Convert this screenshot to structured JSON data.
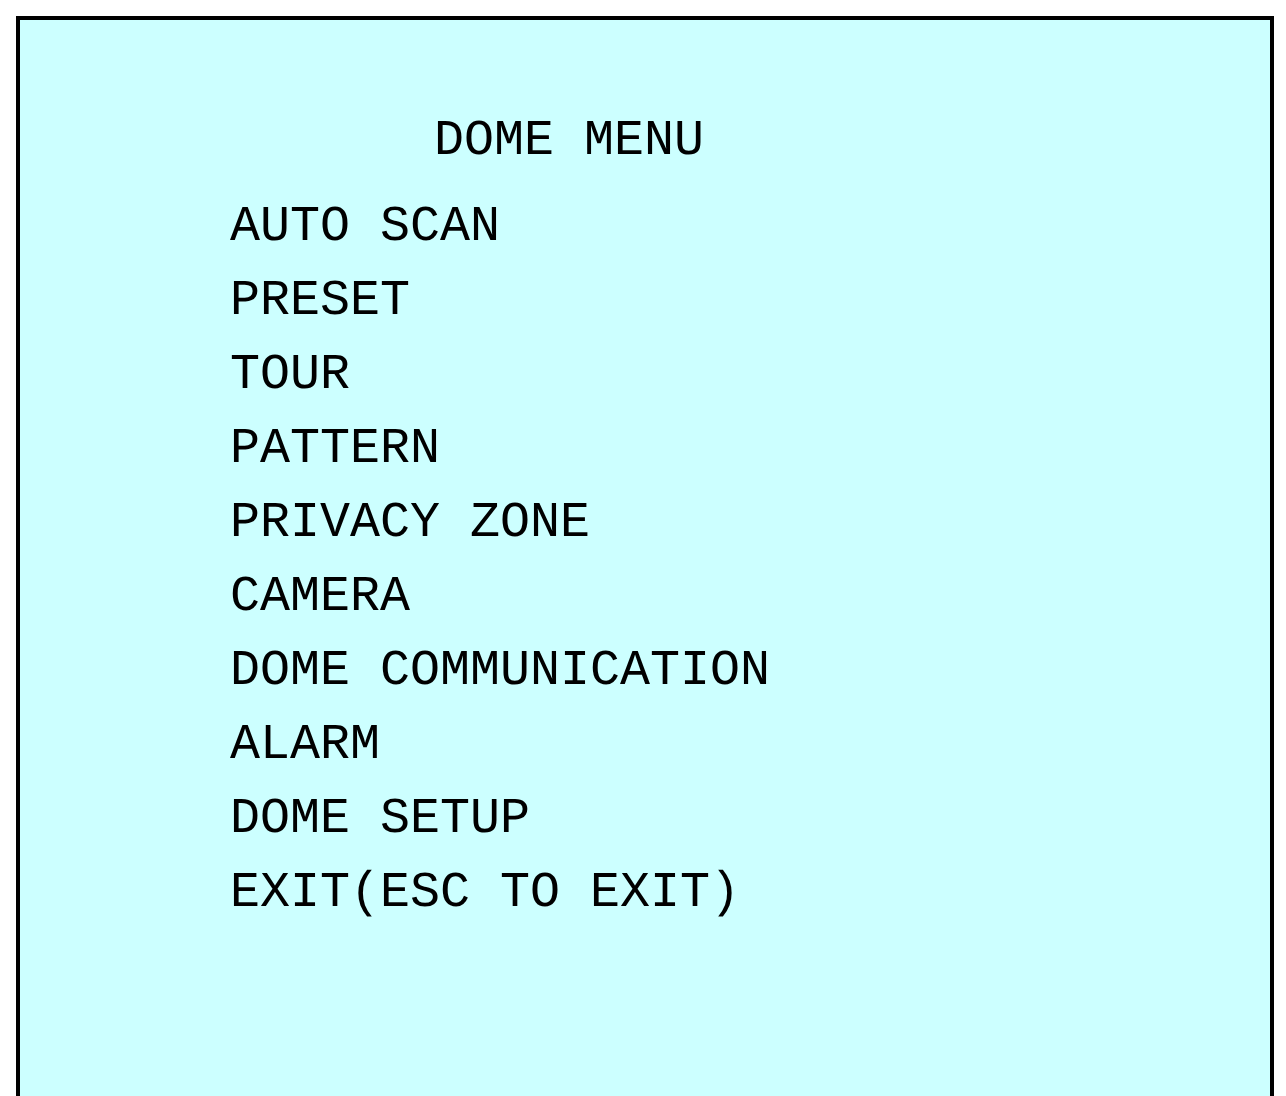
{
  "menu": {
    "title": "DOME MENU",
    "items": [
      "AUTO SCAN",
      "PRESET",
      "TOUR",
      "PATTERN",
      "PRIVACY ZONE",
      "CAMERA",
      "DOME COMMUNICATION",
      "ALARM",
      "DOME SETUP",
      "EXIT(ESC TO EXIT)"
    ]
  }
}
